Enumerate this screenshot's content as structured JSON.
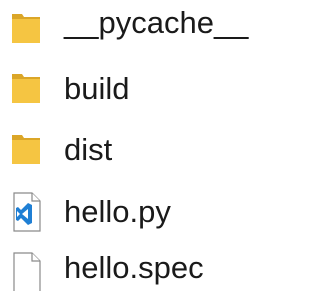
{
  "explorer": {
    "items": [
      {
        "label": "__pycache__",
        "icon": "folder-icon"
      },
      {
        "label": "build",
        "icon": "folder-icon"
      },
      {
        "label": "dist",
        "icon": "folder-icon"
      },
      {
        "label": "hello.py",
        "icon": "vscode-file-icon"
      },
      {
        "label": "hello.spec",
        "icon": "blank-file-icon"
      }
    ]
  },
  "colors": {
    "folder": "#f5c542",
    "folder_dark": "#dba628",
    "vscode_blue": "#1f7fd4",
    "text": "#1a1a1a"
  }
}
